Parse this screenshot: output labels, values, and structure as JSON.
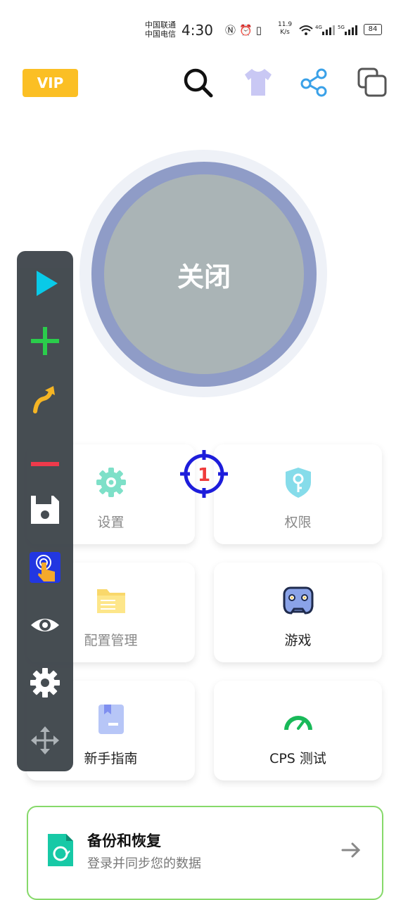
{
  "status_bar": {
    "carrier_1": "中国联通",
    "carrier_2": "中国电信",
    "time": "4:30",
    "net_speed_value": "11.9",
    "net_speed_unit": "K/s",
    "battery": "84",
    "network_4g": "4G",
    "network_5g": "5G"
  },
  "header": {
    "vip_label": "VIP"
  },
  "toggle": {
    "label": "关闭"
  },
  "cards": {
    "settings": "设置",
    "permissions": "权限",
    "config_manage": "配置管理",
    "games": "游戏",
    "guide": "新手指南",
    "cps_test": "CPS 测试"
  },
  "backup": {
    "title": "备份和恢复",
    "subtitle": "登录并同步您的数据"
  },
  "target_marker": {
    "number": "1"
  },
  "colors": {
    "vip": "#fbbf24",
    "ring": "#8f9cc7",
    "toggle": "#aab4b6",
    "toolbar": "#3f464c",
    "accent_green": "#22cc44"
  }
}
